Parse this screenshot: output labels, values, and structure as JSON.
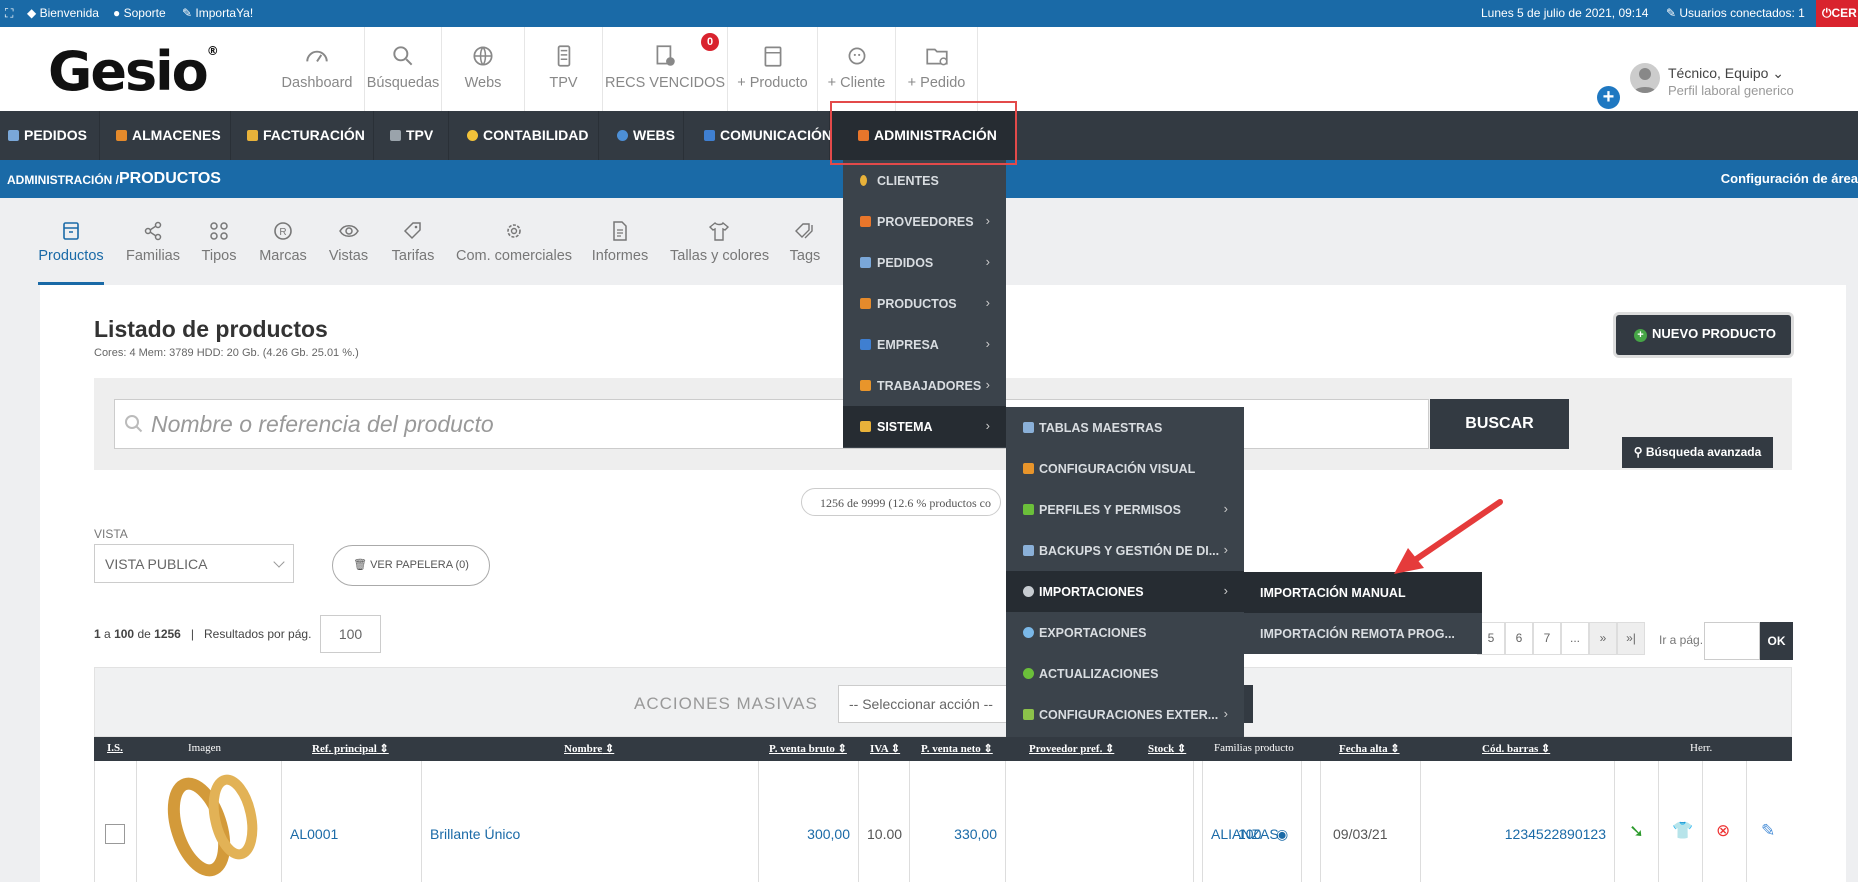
{
  "topbar": {
    "welcome": "Bienvenida",
    "support": "Soporte",
    "importa": "ImportaYa!",
    "datetime": "Lunes 5 de julio de 2021, 09:14",
    "users_connected": "Usuarios conectados: 1",
    "cut_label": "CER"
  },
  "header": {
    "logo": "Gesio",
    "items": [
      {
        "label": "Dashboard",
        "icon": "gauge-icon"
      },
      {
        "label": "Búsquedas",
        "icon": "search-icon"
      },
      {
        "label": "Webs",
        "icon": "globe-icon"
      },
      {
        "label": "TPV",
        "icon": "pos-terminal-icon"
      },
      {
        "label": "RECS VENCIDOS",
        "icon": "receipt-icon",
        "badge": "0"
      },
      {
        "label": "+ Producto",
        "icon": "box-icon"
      },
      {
        "label": "+ Cliente",
        "icon": "face-icon"
      },
      {
        "label": "+ Pedido",
        "icon": "folder-add-icon"
      }
    ],
    "user": {
      "name": "Técnico, Equipo",
      "role": "Perfil laboral generico"
    }
  },
  "nav": {
    "items": [
      "PEDIDOS",
      "ALMACENES",
      "FACTURACIÓN",
      "TPV",
      "CONTABILIDAD",
      "WEBS",
      "COMUNICACIÓN",
      "ADMINISTRACIÓN"
    ]
  },
  "breadcrumb": {
    "section": "ADMINISTRACIÓN /",
    "page": "PRODUCTOS",
    "config": "Configuración de área"
  },
  "tabs": [
    "Productos",
    "Familias",
    "Tipos",
    "Marcas",
    "Vistas",
    "Tarifas",
    "Com. comerciales",
    "Informes",
    "Tallas y colores",
    "Tags"
  ],
  "content": {
    "title": "Listado de productos",
    "sysinfo": "Cores: 4 Mem: 3789 HDD: 20 Gb. (4.26 Gb. 25.01 %.)",
    "new_button": "NUEVO PRODUCTO",
    "search_placeholder": "Nombre o referencia del producto",
    "search_button": "BUSCAR",
    "advanced_search": "Búsqueda avanzada",
    "count_text": "1256 de 9999 (12.6 % productos co",
    "vista_label": "VISTA",
    "vista_value": "VISTA PUBLICA",
    "papelera": "VER PAPELERA (0)",
    "pager_info_a": "1",
    "pager_info_b": "a",
    "pager_info_c": "100",
    "pager_info_d": "de",
    "pager_info_e": "1256",
    "pager_sep": "|",
    "per_page_label": "Resultados por pág.",
    "per_page_value": "100",
    "pages": [
      "5",
      "6",
      "7",
      "...",
      "»",
      "»|"
    ],
    "goto_label": "Ir a pág.",
    "ok": "OK",
    "mass_actions": "ACCIONES MASIVAS",
    "mass_select": "-- Seleccionar acción --"
  },
  "table": {
    "headers": [
      "I.S.",
      "Imagen",
      "Ref. principal",
      "Nombre",
      "P. venta bruto",
      "IVA",
      "P. venta neto",
      "Proveedor pref.",
      "Stock",
      "Familias producto",
      "Fecha alta",
      "Cód. barras",
      "Herr."
    ],
    "row": {
      "ref": "AL0001",
      "name": "Brillante Único",
      "gross": "300,00",
      "iva": "10.00",
      "net": "330,00",
      "supplier": "",
      "stock": "100",
      "family": "ALIANZAS",
      "date": "09/03/21",
      "barcode": "1234522890123"
    }
  },
  "menu_admin": {
    "items": [
      {
        "label": "CLIENTES",
        "icon": "bulb-icon"
      },
      {
        "label": "PROVEEDORES",
        "icon": "supplier-icon"
      },
      {
        "label": "PEDIDOS",
        "icon": "order-icon"
      },
      {
        "label": "PRODUCTOS",
        "icon": "box-icon"
      },
      {
        "label": "EMPRESA",
        "icon": "building-icon"
      },
      {
        "label": "TRABAJADORES",
        "icon": "workers-icon"
      },
      {
        "label": "SISTEMA",
        "icon": "tools-icon"
      }
    ]
  },
  "menu_sistema": {
    "items": [
      {
        "label": "TABLAS MAESTRAS",
        "icon": "table-icon"
      },
      {
        "label": "CONFIGURACIÓN VISUAL",
        "icon": "brush-icon"
      },
      {
        "label": "PERFILES Y PERMISOS",
        "icon": "profile-icon"
      },
      {
        "label": "BACKUPS Y GESTIÓN DE DI...",
        "icon": "backup-icon"
      },
      {
        "label": "IMPORTACIONES",
        "icon": "cloud-import-icon"
      },
      {
        "label": "EXPORTACIONES",
        "icon": "cloud-export-icon"
      },
      {
        "label": "ACTUALIZACIONES",
        "icon": "update-icon"
      },
      {
        "label": "CONFIGURACIONES EXTER...",
        "icon": "puzzle-icon"
      }
    ]
  },
  "menu_importaciones": {
    "items": [
      "IMPORTACIÓN MANUAL",
      "IMPORTACIÓN REMOTA PROG..."
    ]
  }
}
